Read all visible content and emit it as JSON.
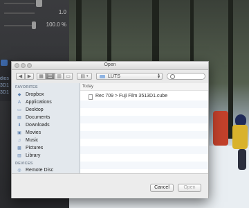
{
  "background_app": {
    "params": [
      {
        "value": "",
        "knob": "true"
      },
      {
        "value": "1.0"
      },
      {
        "value": "100.0 %"
      }
    ],
    "side_labels": [
      "dios",
      "3D1",
      "3D1"
    ]
  },
  "dialog": {
    "title": "Open",
    "toolbar": {
      "back_icon": "◀",
      "forward_icon": "▶",
      "view_icon_glyph": "▦",
      "list_glyph": "☰",
      "column_glyph": "▥",
      "coverflow_glyph": "▭",
      "arrange_glyph": "▤",
      "location": "LUTS",
      "search_placeholder": ""
    },
    "sidebar": {
      "favorites_heading": "FAVORITES",
      "favorites": [
        {
          "label": "Dropbox",
          "icon": "dropbox-icon",
          "glyph": "◆"
        },
        {
          "label": "Applications",
          "icon": "applications-icon",
          "glyph": "A"
        },
        {
          "label": "Desktop",
          "icon": "desktop-icon",
          "glyph": "▭"
        },
        {
          "label": "Documents",
          "icon": "documents-icon",
          "glyph": "▤"
        },
        {
          "label": "Downloads",
          "icon": "downloads-icon",
          "glyph": "⬇"
        },
        {
          "label": "Movies",
          "icon": "movies-icon",
          "glyph": "▣"
        },
        {
          "label": "Music",
          "icon": "music-icon",
          "glyph": "♫"
        },
        {
          "label": "Pictures",
          "icon": "pictures-icon",
          "glyph": "▩"
        },
        {
          "label": "Library",
          "icon": "library-icon",
          "glyph": "▥"
        }
      ],
      "devices_heading": "DEVICES",
      "devices": [
        {
          "label": "Remote Disc",
          "icon": "disc-icon",
          "glyph": "◎"
        }
      ]
    },
    "files": {
      "group": "Today",
      "items": [
        {
          "name": "Rec 709 > Fuji Film 3513D1.cube",
          "icon": "cube-file-icon"
        }
      ]
    },
    "buttons": {
      "cancel": "Cancel",
      "open": "Open"
    }
  },
  "colors": {
    "sidebar_bg": "#e3e8ed",
    "accent": "#3d68a8"
  }
}
